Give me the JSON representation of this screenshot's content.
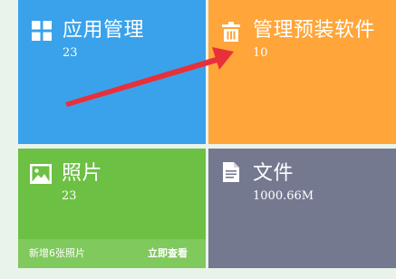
{
  "tiles": {
    "apps": {
      "title": "应用管理",
      "count": "23",
      "icon": "grid-icon",
      "color": "#3aa2ea"
    },
    "preinstalled": {
      "title": "管理预装软件",
      "count": "10",
      "icon": "trash-icon",
      "color": "#ffa53a"
    },
    "photos": {
      "title": "照片",
      "count": "23",
      "icon": "image-icon",
      "color": "#6cc043",
      "footer": {
        "new_photos": "新增6张照片",
        "view_now": "立即查看"
      }
    },
    "files": {
      "title": "文件",
      "count": "1000.66M",
      "icon": "document-icon",
      "color": "#747990"
    }
  },
  "annotation": {
    "arrow_color": "#e8303a"
  }
}
